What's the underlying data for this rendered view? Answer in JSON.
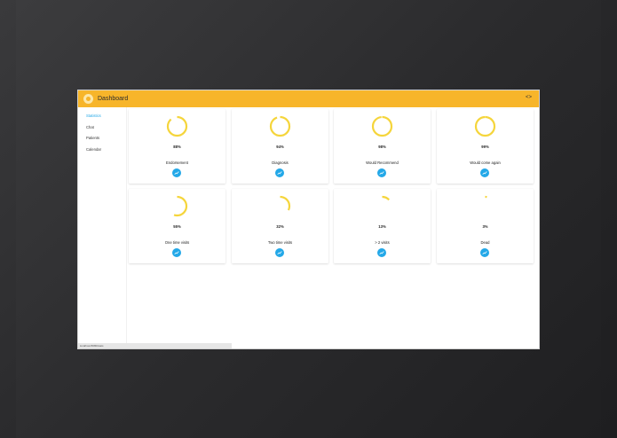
{
  "header": {
    "title": "Dashboard",
    "code_icon": "<>"
  },
  "sidebar": {
    "items": [
      {
        "label": "Statistics",
        "active": true
      },
      {
        "label": "Chat",
        "active": false
      },
      {
        "label": "Patients",
        "active": false
      },
      {
        "label": "Calendar",
        "active": false
      }
    ]
  },
  "statusbar": {
    "text": "localhost:8080/stats"
  },
  "colors": {
    "accent": "#f7b52a",
    "ring": "#f5d53b",
    "fab": "#23a8e8",
    "active_nav": "#23a8e8"
  },
  "cards": [
    {
      "percent_label": "88%",
      "percent": 88,
      "label": "Endorsement"
    },
    {
      "percent_label": "94%",
      "percent": 94,
      "label": "Diagnosis"
    },
    {
      "percent_label": "98%",
      "percent": 98,
      "label": "Would Recommend"
    },
    {
      "percent_label": "99%",
      "percent": 99,
      "label": "Would come again"
    },
    {
      "percent_label": "55%",
      "percent": 55,
      "label": "One time visits"
    },
    {
      "percent_label": "32%",
      "percent": 32,
      "label": "Two time visits"
    },
    {
      "percent_label": "13%",
      "percent": 13,
      "label": "> 2 visits"
    },
    {
      "percent_label": "3%",
      "percent": 3,
      "label": "Dead"
    }
  ]
}
